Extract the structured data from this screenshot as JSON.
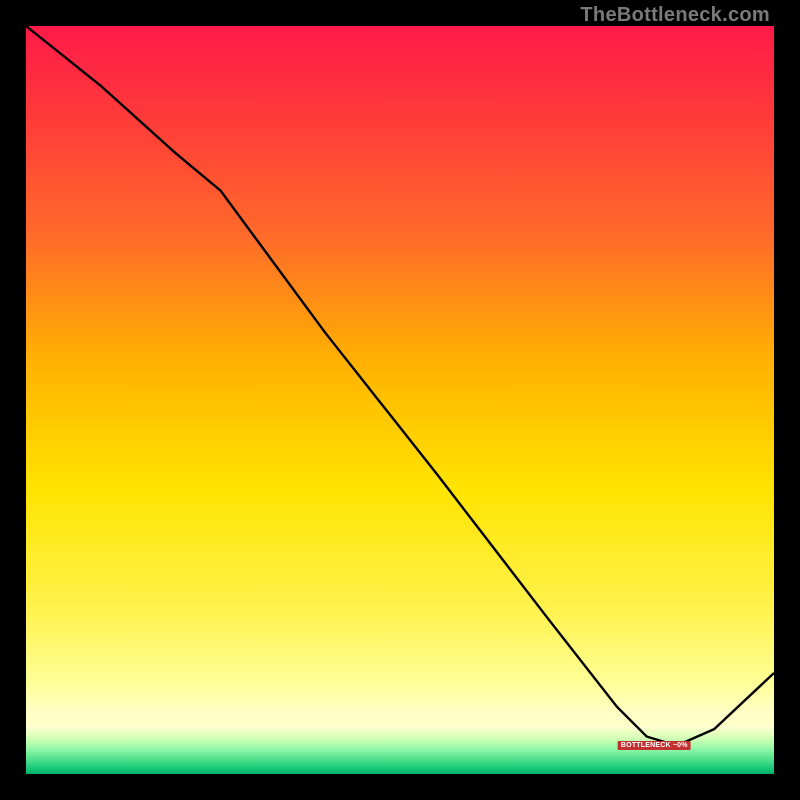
{
  "watermark": "TheBottleneck.com",
  "annotation_label": "BOTTLENECK ~0%",
  "gradient": {
    "stops": [
      {
        "offset": 0.0,
        "color": "#ff1a49"
      },
      {
        "offset": 0.12,
        "color": "#ff3a3a"
      },
      {
        "offset": 0.28,
        "color": "#ff6a2a"
      },
      {
        "offset": 0.45,
        "color": "#ffb200"
      },
      {
        "offset": 0.62,
        "color": "#ffe400"
      },
      {
        "offset": 0.78,
        "color": "#fff24d"
      },
      {
        "offset": 0.88,
        "color": "#ffff99"
      },
      {
        "offset": 0.92,
        "color": "#ffffc8"
      }
    ]
  },
  "green_band": {
    "height_frac": 0.065,
    "stops": [
      {
        "offset": 0.0,
        "color": "#ffffd2"
      },
      {
        "offset": 0.15,
        "color": "#eaffc0"
      },
      {
        "offset": 0.3,
        "color": "#c9ffb4"
      },
      {
        "offset": 0.5,
        "color": "#8cf7a7"
      },
      {
        "offset": 0.7,
        "color": "#4fe08c"
      },
      {
        "offset": 0.88,
        "color": "#18c977"
      },
      {
        "offset": 1.0,
        "color": "#00b06a"
      }
    ]
  },
  "chart_data": {
    "type": "line",
    "title": "",
    "xlabel": "",
    "ylabel": "",
    "xlim": [
      0,
      1
    ],
    "ylim": [
      0,
      1
    ],
    "series": [
      {
        "name": "bottleneck-curve",
        "x": [
          0.0,
          0.1,
          0.2,
          0.26,
          0.4,
          0.55,
          0.7,
          0.79,
          0.83,
          0.87,
          0.92,
          1.0
        ],
        "y": [
          1.0,
          0.92,
          0.83,
          0.78,
          0.59,
          0.4,
          0.205,
          0.09,
          0.05,
          0.038,
          0.06,
          0.135
        ]
      }
    ],
    "annotation": {
      "x": 0.84,
      "y": 0.038,
      "text": "BOTTLENECK ~0%"
    }
  }
}
